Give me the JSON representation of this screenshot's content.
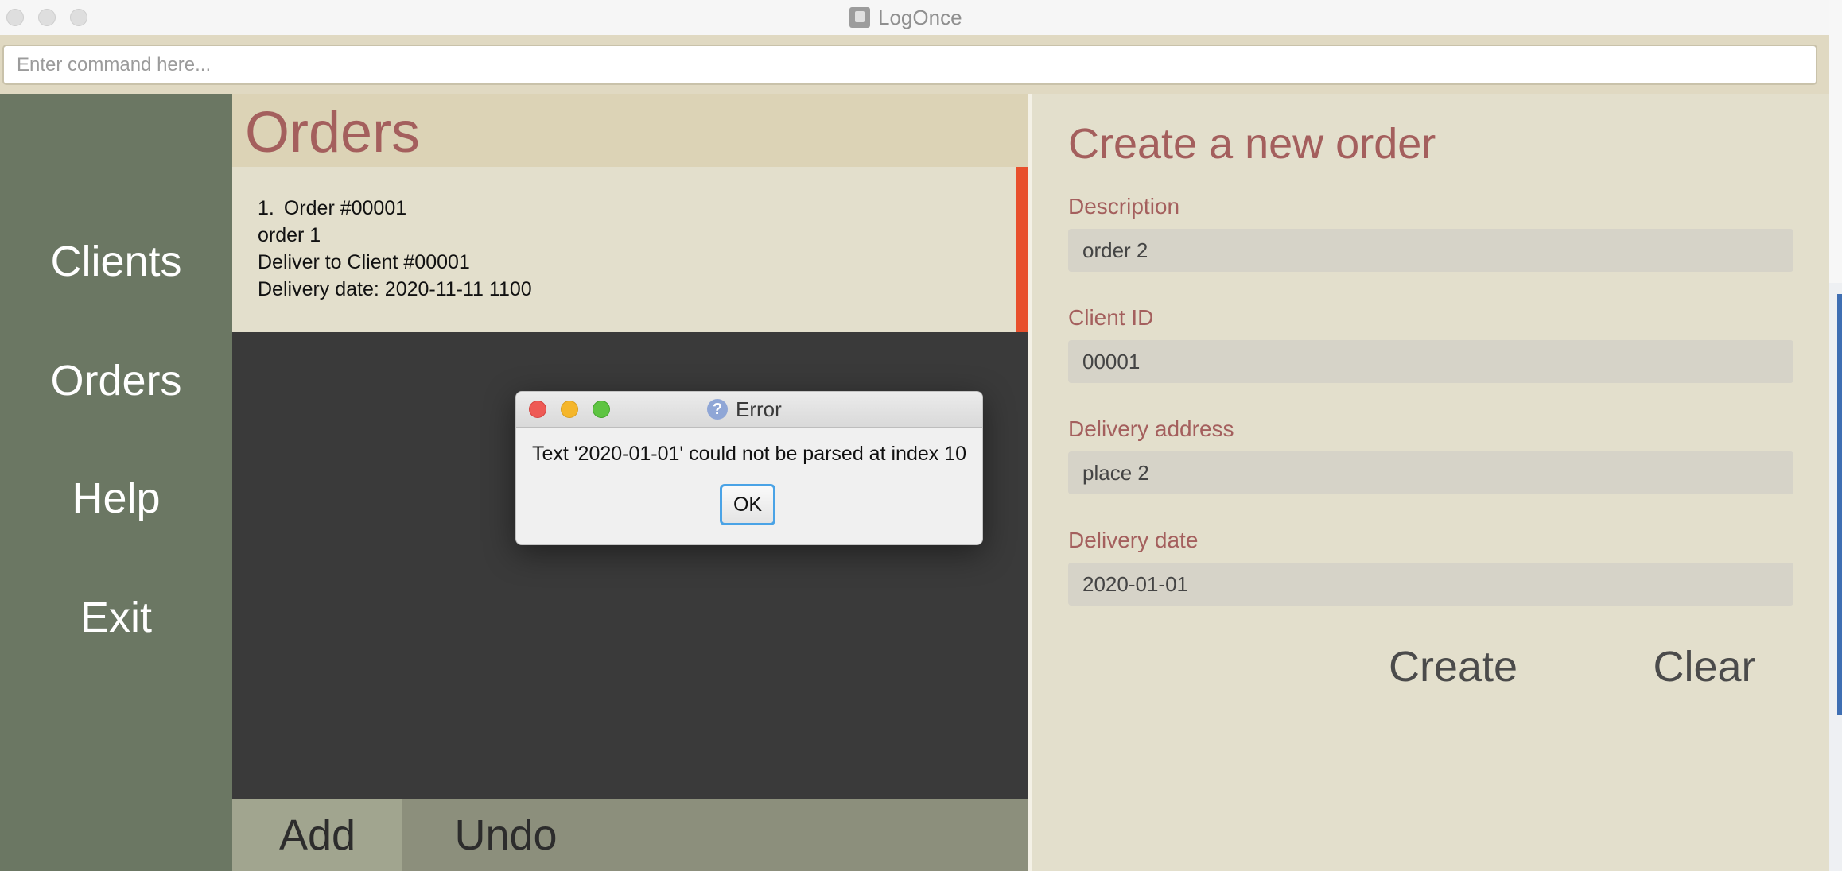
{
  "window": {
    "title": "LogOnce"
  },
  "command": {
    "placeholder": "Enter command here..."
  },
  "sidebar": {
    "items": [
      {
        "label": "Clients"
      },
      {
        "label": "Orders"
      },
      {
        "label": "Help"
      },
      {
        "label": "Exit"
      }
    ]
  },
  "orders": {
    "title": "Orders",
    "list": [
      {
        "index": "1.",
        "order_number": "Order #00001",
        "description": "order 1",
        "client": "Deliver to Client #00001",
        "date": "Delivery date: 2020-11-11 1100"
      }
    ],
    "accent_color": "#e8502c"
  },
  "bottom_bar": {
    "add_label": "Add",
    "undo_label": "Undo"
  },
  "form": {
    "title": "Create a new order",
    "description_label": "Description",
    "description_value": "order 2",
    "client_label": "Client ID",
    "client_value": "00001",
    "address_label": "Delivery address",
    "address_value": "place 2",
    "date_label": "Delivery date",
    "date_value": "2020-01-01",
    "create_label": "Create",
    "clear_label": "Clear"
  },
  "dialog": {
    "title": "Error",
    "message": "Text '2020-01-01' could not be parsed at index 10",
    "ok_label": "OK"
  },
  "colors": {
    "sidebar": "#6b7763",
    "accent_text": "#a45f5d",
    "panel_bg": "#e3dfcc",
    "list_bg": "#3a3a3a"
  }
}
